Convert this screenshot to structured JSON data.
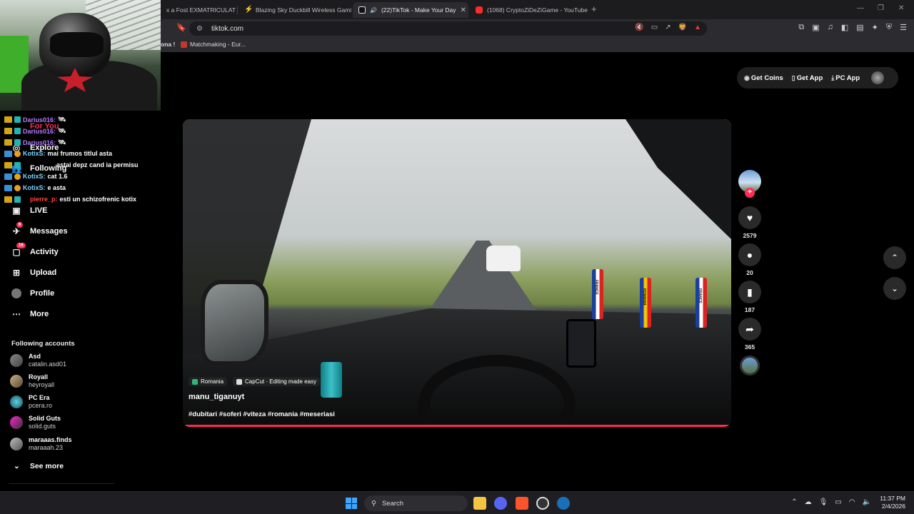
{
  "browser": {
    "tabs": [
      {
        "title": "x a Fost EXMATRICULAT di"
      },
      {
        "title": "Blazing Sky Duckbill Wireless Gaming"
      },
      {
        "title": "(22)TikTok - Make Your Day"
      },
      {
        "title": "(1068) CryptoZiDeZiGame - YouTube"
      }
    ],
    "new_tab": "+",
    "url": "tiktok.com",
    "bookmarks_prev": "ona !",
    "bookmark": "Matchmaking - Eur..."
  },
  "chat": [
    {
      "user": "Darius016:",
      "msg": "🛰"
    },
    {
      "user": "Darius016:",
      "msg": "🛰"
    },
    {
      "user": "Darius016:",
      "msg": "🛰"
    },
    {
      "user": "KotixS:",
      "msg": "mai frumos titlul asta"
    },
    {
      "user": "",
      "msg": "astai depz cand ia permisu"
    },
    {
      "user": "KotixS:",
      "msg": "cat 1.6"
    },
    {
      "user": "KotixS:",
      "msg": "e asta"
    },
    {
      "user": "pierre_p:",
      "msg": "esti un schizofrenic kotix"
    }
  ],
  "sidebar": {
    "nav": [
      {
        "label": "For You"
      },
      {
        "label": "Explore"
      },
      {
        "label": "Following"
      },
      {
        "label": "LIVE"
      },
      {
        "label": "Messages",
        "badge": "6"
      },
      {
        "label": "Activity",
        "badge": "16"
      },
      {
        "label": "Upload"
      },
      {
        "label": "Profile"
      },
      {
        "label": "More"
      }
    ],
    "following_title": "Following accounts",
    "accounts": [
      {
        "name": "Asd",
        "handle": "catalin.asd01"
      },
      {
        "name": "Royall",
        "handle": "heyroyall"
      },
      {
        "name": "PC Era",
        "handle": "pcera.ro"
      },
      {
        "name": "Solid Guts",
        "handle": "solid.guts"
      },
      {
        "name": "maraaas.finds",
        "handle": "maraaah.23"
      }
    ],
    "see_more": "See more"
  },
  "top_actions": {
    "get_coins": "Get Coins",
    "get_app": "Get App",
    "pc_app": "PC App"
  },
  "video": {
    "location_tag": "Romania",
    "capcut_tag": "CapCut · Editing made easy",
    "author": "manu_tiganuyt",
    "hashtags": "#dubitari #soferi #viteza #romania #meseriasi",
    "flag_words": [
      "FRANCE",
      "ROMANIA",
      "FRANCE"
    ]
  },
  "actions": {
    "likes": "2579",
    "comments": "20",
    "saves": "187",
    "shares": "365"
  },
  "taskbar": {
    "search": "Search",
    "time": "11:37 PM",
    "date": "2/4/2026"
  },
  "colors": {
    "accent": "#fe2c55",
    "background": "#000000"
  }
}
